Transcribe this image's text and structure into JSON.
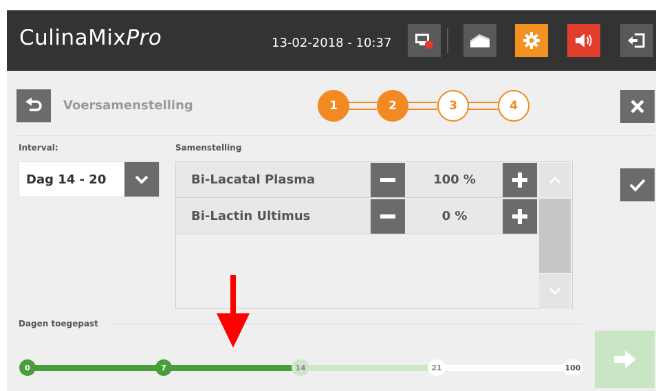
{
  "header": {
    "app_title_main": "CulinaMix",
    "app_title_italic": "Pro",
    "datetime": "13-02-2018 - 10:37",
    "buttons": [
      {
        "icon": "monitor-alert-icon",
        "color": "#595959"
      },
      {
        "icon": "barn-icon",
        "color": "#595959"
      },
      {
        "icon": "gear-icon",
        "color": "#f39223"
      },
      {
        "icon": "speaker-icon",
        "color": "#e13d2c"
      },
      {
        "icon": "logout-icon",
        "color": "#595959"
      }
    ]
  },
  "wizard": {
    "title": "Voersamenstelling",
    "steps": [
      {
        "label": "1",
        "state": "done"
      },
      {
        "label": "2",
        "state": "done"
      },
      {
        "label": "3",
        "state": "todo"
      },
      {
        "label": "4",
        "state": "todo"
      }
    ],
    "accent_color": "#f28a21"
  },
  "interval": {
    "label": "Interval:",
    "value": "Dag 14 - 20"
  },
  "composition": {
    "label": "Samenstelling",
    "rows": [
      {
        "name": "Bi-Lacatal Plasma",
        "percent": "100 %"
      },
      {
        "name": "Bi-Lactin Ultimus",
        "percent": "0 %"
      }
    ]
  },
  "days": {
    "label": "Dagen toegepast",
    "nodes": [
      {
        "label": "0",
        "state": "applied"
      },
      {
        "label": "7",
        "state": "applied"
      },
      {
        "label": "14",
        "state": "current"
      },
      {
        "label": "21",
        "state": "future"
      },
      {
        "label": "100",
        "state": "future"
      }
    ],
    "colors": {
      "applied": "#4a9e3a",
      "current": "#cfe6c8",
      "future": "#ffffff"
    }
  }
}
